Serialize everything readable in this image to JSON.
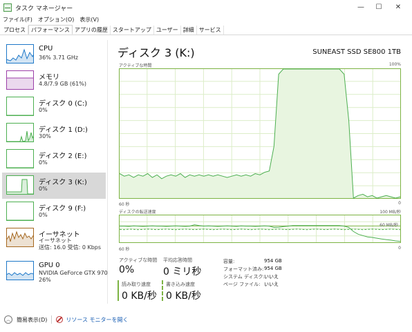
{
  "window": {
    "title": "タスク マネージャー",
    "min_glyph": "—",
    "max_glyph": "☐",
    "close_glyph": "✕"
  },
  "menu": [
    "ファイル(F)",
    "オプション(O)",
    "表示(V)"
  ],
  "tabs": [
    {
      "label": "プロセス",
      "active": false
    },
    {
      "label": "パフォーマンス",
      "active": true
    },
    {
      "label": "アプリの履歴",
      "active": false
    },
    {
      "label": "スタートアップ",
      "active": false
    },
    {
      "label": "ユーザー",
      "active": false
    },
    {
      "label": "詳細",
      "active": false
    },
    {
      "label": "サービス",
      "active": false
    }
  ],
  "sidebar": {
    "items": [
      {
        "title": "CPU",
        "sub": "36% 3.71 GHz",
        "kind": "cpu",
        "color": "#1e78c8",
        "selected": false
      },
      {
        "title": "メモリ",
        "sub": "4.8/7.9 GB (61%)",
        "kind": "memory",
        "color": "#9c3fa8",
        "selected": false
      },
      {
        "title": "ディスク 0 (C:)",
        "sub": "0%",
        "kind": "disk0",
        "color": "#4caf50",
        "selected": false
      },
      {
        "title": "ディスク 1 (D:)",
        "sub": "30%",
        "kind": "disk1",
        "color": "#4caf50",
        "selected": false
      },
      {
        "title": "ディスク 2 (E:)",
        "sub": "0%",
        "kind": "disk2",
        "color": "#4caf50",
        "selected": false
      },
      {
        "title": "ディスク 3 (K:)",
        "sub": "0%",
        "kind": "disk3",
        "color": "#4caf50",
        "selected": true
      },
      {
        "title": "ディスク 9 (F:)",
        "sub": "0%",
        "kind": "disk9",
        "color": "#4caf50",
        "selected": false
      },
      {
        "title": "イーサネット",
        "sub": "イーサネット",
        "sub2": "送信: 16.0 受信: 0 Kbps",
        "kind": "ethernet",
        "color": "#a5671f",
        "selected": false
      },
      {
        "title": "GPU 0",
        "sub": "NVIDIA GeForce GTX 970",
        "sub2": "26%",
        "kind": "gpu",
        "color": "#1e78c8",
        "selected": false
      }
    ]
  },
  "main": {
    "title": "ディスク 3 (K:)",
    "model": "SUNEAST SSD SE800 1TB",
    "active_time_label": "アクティブな時間",
    "active_time_max": "100%",
    "seconds_label": "60 秒",
    "zero_label": "0",
    "transfer_label": "ディスクの転送速度",
    "transfer_max": "100 MB/秒",
    "transfer_mid": "60 MB/秒",
    "stats": {
      "active_time": {
        "label": "アクティブな時間",
        "value": "0%"
      },
      "avg_response": {
        "label": "平均応答時間",
        "value": "0 ミリ秒"
      },
      "read_speed": {
        "label": "読み取り速度",
        "value": "0 KB/秒"
      },
      "write_speed": {
        "label": "書き込み速度",
        "value": "0 KB/秒"
      }
    },
    "properties": [
      {
        "key": "容量:",
        "value": "954 GB"
      },
      {
        "key": "フォーマット済み:",
        "value": "954 GB"
      },
      {
        "key": "システム ディスク:",
        "value": "いいえ"
      },
      {
        "key": "ページ ファイル:",
        "value": "いいえ"
      }
    ]
  },
  "footer": {
    "fewer_details": "簡易表示(D)",
    "resource_monitor": "リソース モニターを開く"
  },
  "chart_data": [
    {
      "type": "area",
      "title": "アクティブな時間",
      "ylim": [
        0,
        100
      ],
      "y_unit": "%",
      "x_label": "60 秒",
      "grid": true,
      "series": [
        {
          "color": "#4caf50",
          "values": [
            19,
            17,
            18,
            16,
            18,
            17,
            19,
            16,
            18,
            15,
            17,
            18,
            17,
            19,
            16,
            18,
            17,
            18,
            17,
            18,
            17,
            18,
            17,
            16,
            17,
            18,
            17,
            18,
            17,
            19,
            18,
            20,
            21,
            40,
            96,
            100,
            100,
            100,
            100,
            100,
            100,
            100,
            100,
            100,
            100,
            100,
            100,
            100,
            96,
            60,
            0,
            2,
            3,
            1,
            2,
            0,
            1,
            2,
            1,
            0,
            1
          ]
        }
      ]
    },
    {
      "type": "line",
      "title": "ディスクの転送速度",
      "ylim": [
        0,
        100
      ],
      "y_unit": "MB/秒",
      "reference_line": 60,
      "x_label": "60 秒",
      "grid": true,
      "series": [
        {
          "color": "#4caf50",
          "values": [
            60,
            60,
            59,
            61,
            60,
            59,
            60,
            61,
            60,
            60,
            59,
            60,
            61,
            60,
            59,
            60,
            65,
            62,
            60,
            61,
            60,
            59,
            60,
            61,
            60,
            59,
            61,
            60,
            60,
            59,
            60,
            61,
            60,
            55,
            56,
            58,
            60,
            62,
            62,
            62,
            62,
            62,
            62,
            62,
            62,
            62,
            62,
            62,
            60,
            55,
            40,
            30,
            25,
            20,
            18,
            15,
            12,
            10,
            8,
            5,
            3
          ]
        },
        {
          "color": "#4caf50",
          "dashed": true,
          "values": [
            48,
            47,
            49,
            48,
            47,
            48,
            49,
            48,
            47,
            48,
            49,
            48,
            47,
            48,
            49,
            48,
            47,
            48,
            49,
            48,
            47,
            48,
            49,
            48,
            47,
            48,
            49,
            48,
            47,
            48,
            49,
            48,
            47,
            48,
            49,
            48,
            47,
            48,
            49,
            48,
            47,
            48,
            49,
            48,
            47,
            48,
            49,
            48,
            47,
            48,
            49,
            48,
            47,
            48,
            49,
            48,
            47,
            48,
            49,
            48,
            47
          ]
        }
      ]
    }
  ]
}
